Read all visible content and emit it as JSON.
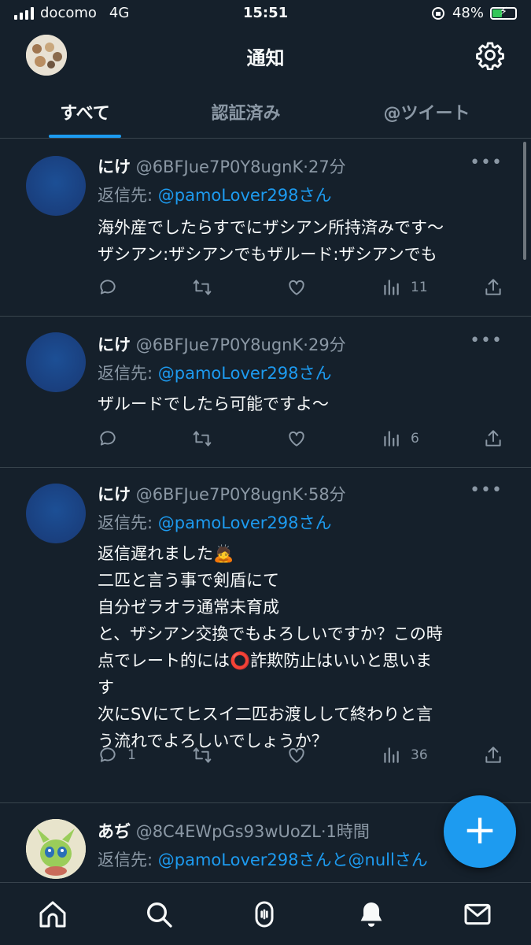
{
  "status_bar": {
    "carrier": "docomo",
    "network": "4G",
    "time": "15:51",
    "battery": "48%",
    "battery_level": 0.48
  },
  "header": {
    "title": "通知"
  },
  "tabs": [
    {
      "label": "すべて",
      "active": true
    },
    {
      "label": "認証済み",
      "active": false
    },
    {
      "label": "@ツイート",
      "active": false
    }
  ],
  "tweets": [
    {
      "name": "にけ",
      "handle": "@6BFJue7P0Y8ugnK",
      "time": "27分",
      "reply_prefix": "返信先: ",
      "reply_to": "@pamoLover298さん",
      "lines": [
        "海外産でしたらすでにザシアン所持済みです〜",
        "ザシアン:ザシアンでもザルード:ザシアンでも"
      ],
      "replies": "",
      "views": "11"
    },
    {
      "name": "にけ",
      "handle": "@6BFJue7P0Y8ugnK",
      "time": "29分",
      "reply_prefix": "返信先: ",
      "reply_to": "@pamoLover298さん",
      "lines": [
        "ザルードでしたら可能ですよ〜"
      ],
      "replies": "",
      "views": "6"
    },
    {
      "name": "にけ",
      "handle": "@6BFJue7P0Y8ugnK",
      "time": "58分",
      "reply_prefix": "返信先: ",
      "reply_to": "@pamoLover298さん",
      "lines": [
        "返信遅れました🙇",
        "二匹と言う事で剣盾にて",
        "自分ゼラオラ通常未育成",
        "と、ザシアン交換でもよろしいですか？この時",
        "点でレート的には⭕詐欺防止はいいと思いま",
        "す",
        "次にSVにてヒスイ二匹お渡しして終わりと言",
        "う流れでよろしいでしょうか？"
      ],
      "replies": "1",
      "views": "36"
    },
    {
      "name": "あぢ",
      "handle": "@8C4EWpGs93wUoZL",
      "time": "1時間",
      "reply_prefix": "返信先: ",
      "reply_to": "@pamoLover298さんと@nullさん"
    }
  ],
  "colors": {
    "background": "#15202b",
    "accent": "#1d9bf0",
    "muted": "#8b98a5",
    "divider": "#38444d"
  },
  "icons": [
    "settings-gear-icon",
    "reply-icon",
    "retweet-icon",
    "like-icon",
    "views-icon",
    "share-icon",
    "home-icon",
    "search-icon",
    "spaces-icon",
    "notifications-icon",
    "messages-icon",
    "compose-plus-icon"
  ]
}
